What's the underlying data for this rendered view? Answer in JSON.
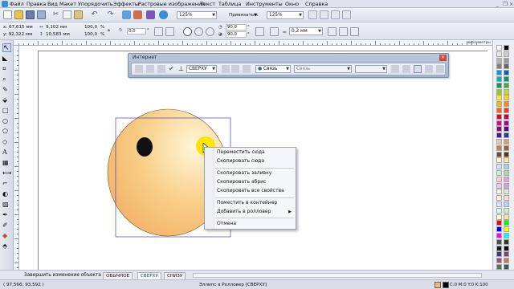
{
  "menu": {
    "items": [
      "Файл",
      "Правка",
      "Вид",
      "Макет",
      "Упорядочить",
      "Эффекты",
      "Растровые изображения",
      "Текст",
      "Таблица",
      "Инструменты",
      "Окно",
      "Справка"
    ]
  },
  "standard_toolbar": {
    "zoom_value": "125%",
    "snap_label": "Привязать к",
    "zoom_value_2": "125%"
  },
  "property_bar": {
    "x": "x: 67,615 мм",
    "y": "y: 92,322 мм",
    "width": "9,102 мм",
    "height": "10,583 мм",
    "scale_x": "100,0",
    "scale_y": "100,0",
    "percent_1": "%",
    "percent_2": "%",
    "rotation": "0,0",
    "angle_start": "90,0",
    "angle_end": "90,0",
    "outline_width": "0,2 мм"
  },
  "ruler": {
    "unit": "миллиметры"
  },
  "internet_toolbar": {
    "title": "Интернет",
    "target_combo": "СВЕРХУ",
    "link_combo": "Связь",
    "link_field": "Связь"
  },
  "context_menu": {
    "items": [
      {
        "label": "Переместить сюда",
        "submenu": false
      },
      {
        "label": "Скопировать сюда",
        "submenu": false
      },
      {
        "label": "Скопировать заливку",
        "submenu": false
      },
      {
        "label": "Скопировать абрис",
        "submenu": false
      },
      {
        "label": "Скопировать все свойства",
        "submenu": false
      },
      {
        "label": "Поместить в контейнер",
        "submenu": false
      },
      {
        "label": "Добавить в ролловер",
        "submenu": true
      },
      {
        "label": "Отмена",
        "submenu": false
      }
    ]
  },
  "document_bar": {
    "tabs": [
      "Завершить изменение объекта",
      "ОБЫЧНОЕ",
      "СВЕРХУ",
      "СНИЗУ"
    ],
    "active_tab": "СВЕРХУ"
  },
  "status_bar": {
    "coordinates": "( 97,566; 93,592 )",
    "object_info": "Эллипс в Ролловер [СВЕРХУ]",
    "fill_info": "C:0 M:0 Y:0 K:100"
  },
  "colors": {
    "face_light": "#fff6d8",
    "face_dark": "#f3b56a",
    "eye": "#111111",
    "highlight": "#ffee00",
    "selection": "#4b3fbf"
  }
}
